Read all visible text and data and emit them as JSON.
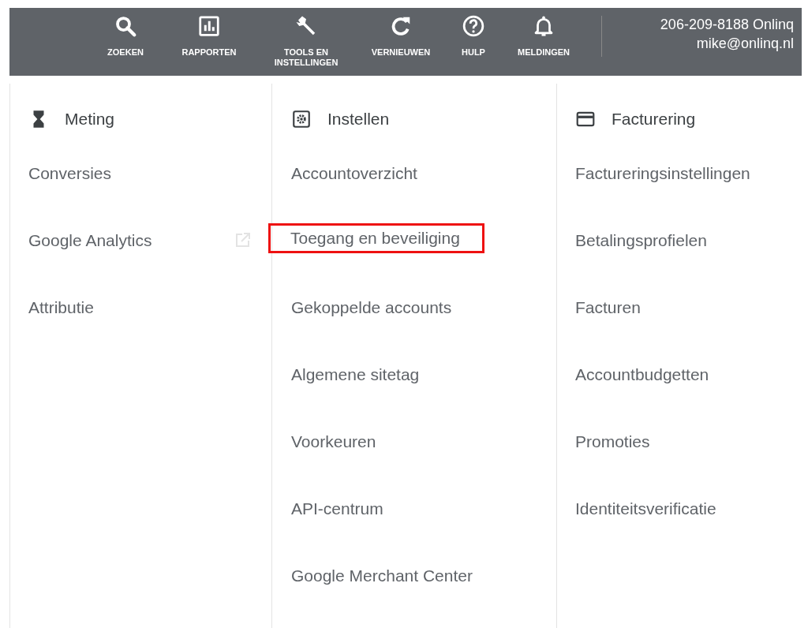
{
  "toolbar": {
    "buttons": [
      {
        "kind": "search",
        "label": "ZOEKEN"
      },
      {
        "kind": "reports",
        "label": "RAPPORTEN"
      },
      {
        "kind": "tools",
        "label": "TOOLS EN INSTELLINGEN"
      },
      {
        "kind": "refresh",
        "label": "VERNIEUWEN"
      },
      {
        "kind": "help",
        "label": "HULP"
      },
      {
        "kind": "bell",
        "label": "MELDINGEN"
      }
    ],
    "account": {
      "phone": "206-209-8188 Onlinq",
      "email": "mike@onlinq.nl"
    }
  },
  "columns": [
    {
      "kind": "hourglass",
      "title": "Meting",
      "items": [
        {
          "label": "Conversies",
          "highlighted": false,
          "external": false
        },
        {
          "label": "Google Analytics",
          "highlighted": false,
          "external": true
        },
        {
          "label": "Attributie",
          "highlighted": false,
          "external": false
        }
      ]
    },
    {
      "kind": "gear",
      "title": "Instellen",
      "items": [
        {
          "label": "Accountoverzicht",
          "highlighted": false,
          "external": false
        },
        {
          "label": "Toegang en beveiliging",
          "highlighted": true,
          "external": false
        },
        {
          "label": "Gekoppelde accounts",
          "highlighted": false,
          "external": false
        },
        {
          "label": "Algemene sitetag",
          "highlighted": false,
          "external": false
        },
        {
          "label": "Voorkeuren",
          "highlighted": false,
          "external": false
        },
        {
          "label": "API-centrum",
          "highlighted": false,
          "external": false
        },
        {
          "label": "Google Merchant Center",
          "highlighted": false,
          "external": false
        }
      ]
    },
    {
      "kind": "card",
      "title": "Facturering",
      "items": [
        {
          "label": "Factureringsinstellingen",
          "highlighted": false,
          "external": false
        },
        {
          "label": "Betalingsprofielen",
          "highlighted": false,
          "external": false
        },
        {
          "label": "Facturen",
          "highlighted": false,
          "external": false
        },
        {
          "label": "Accountbudgetten",
          "highlighted": false,
          "external": false
        },
        {
          "label": "Promoties",
          "highlighted": false,
          "external": false
        },
        {
          "label": "Identiteitsverificatie",
          "highlighted": false,
          "external": false
        }
      ]
    }
  ]
}
